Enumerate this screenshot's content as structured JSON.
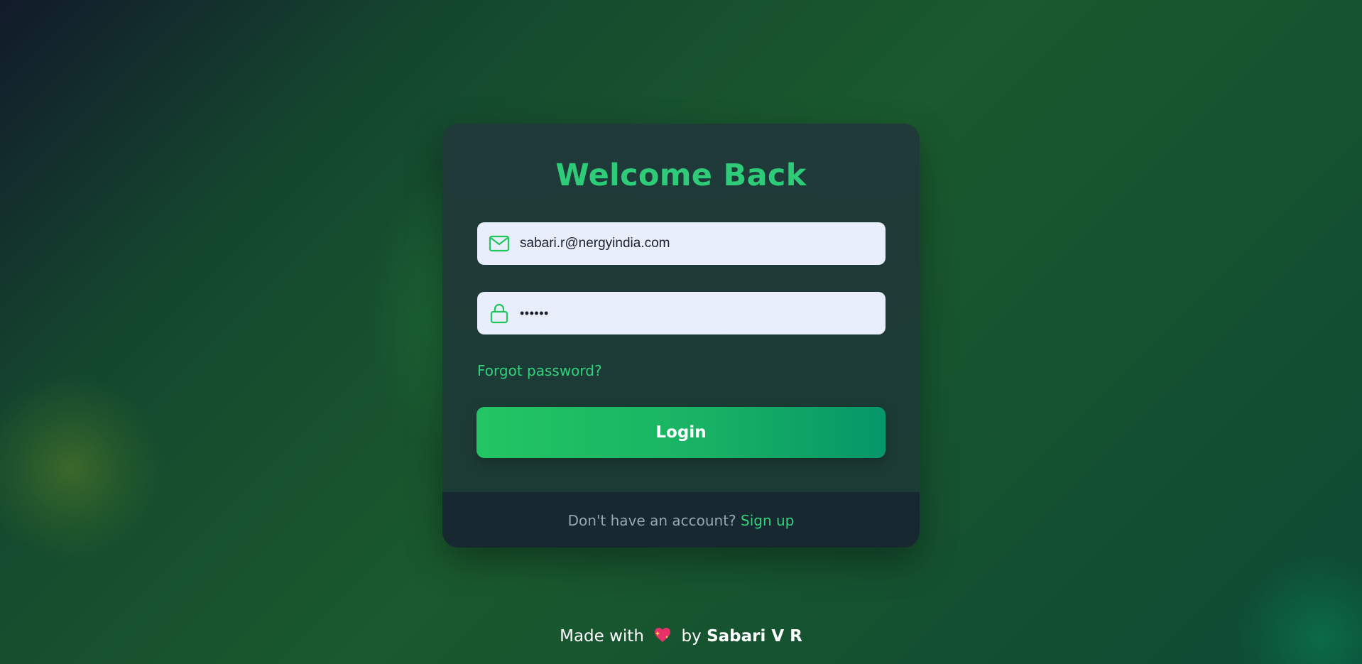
{
  "login_card": {
    "title": "Welcome Back",
    "email": {
      "value": "sabari.r@nergyindia.com",
      "icon": "mail-icon"
    },
    "password": {
      "masked_value": "••••••",
      "icon": "lock-icon"
    },
    "forgot_password_label": "Forgot password?",
    "login_button_label": "Login",
    "footer": {
      "prompt": "Don't have an account?",
      "signup_label": "Sign up"
    }
  },
  "page_footer": {
    "made_with": "Made with",
    "heart_icon": "sparkling-heart-icon",
    "by": "by",
    "author": "Sabari V R"
  },
  "colors": {
    "accent": "#2ecc78",
    "link": "#34d17c",
    "button_gradient_start": "#22c563",
    "button_gradient_end": "#069668",
    "input_background": "#e8eefb",
    "card_background": "#1f3a38",
    "card_footer_background": "#172831"
  }
}
